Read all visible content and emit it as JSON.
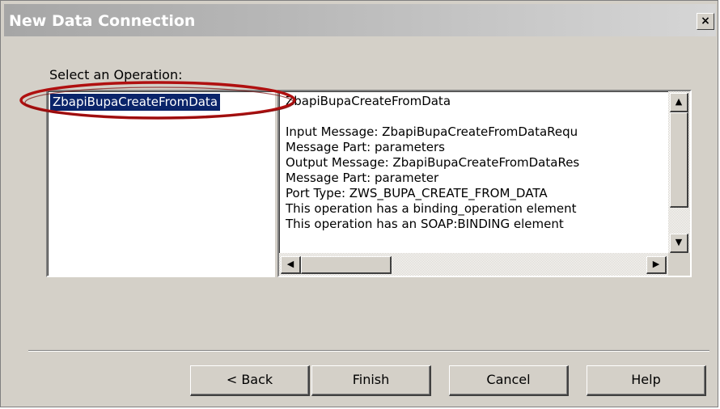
{
  "window": {
    "title": "New Data Connection",
    "close_label": "×"
  },
  "operation": {
    "label": "Select an Operation:",
    "items": [
      "ZbapiBupaCreateFromData"
    ]
  },
  "details": {
    "heading": "ZbapiBupaCreateFromData",
    "lines": [
      "Input Message: ZbapiBupaCreateFromDataRequ",
      "Message Part: parameters",
      "Output Message: ZbapiBupaCreateFromDataRes",
      "Message Part: parameter",
      "Port Type: ZWS_BUPA_CREATE_FROM_DATA",
      "This operation has a binding_operation element",
      "This operation has an SOAP:BINDING element"
    ]
  },
  "scrollbars": {
    "up_icon": "▲",
    "down_icon": "▼",
    "left_icon": "◀",
    "right_icon": "▶"
  },
  "buttons": {
    "back": "< Back",
    "finish": "Finish",
    "cancel": "Cancel",
    "help": "Help"
  },
  "colors": {
    "selection": "#0a246a",
    "annotation": "#b01010"
  }
}
